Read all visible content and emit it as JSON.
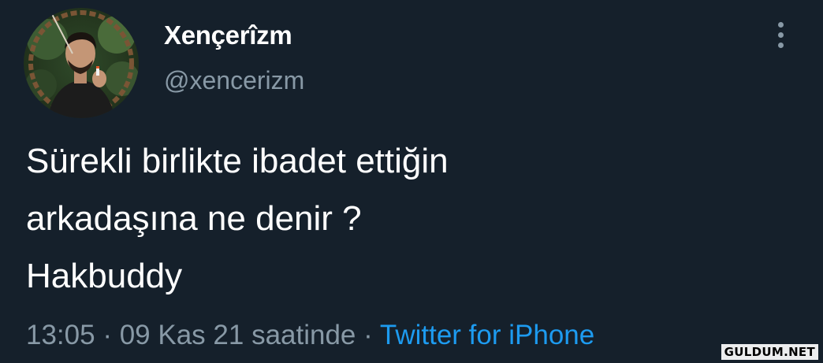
{
  "tweet": {
    "author": {
      "display_name": "Xençerîzm",
      "handle": "@xencerizm",
      "avatar": "profile-photo"
    },
    "more_icon": "more-vertical-icon",
    "text_lines": [
      "Sürekli birlikte ibadet ettiğin",
      "arkadaşına ne denir ?",
      "Hakbuddy"
    ],
    "meta": {
      "time": "13:05",
      "separator": "·",
      "date": "09 Kas 21 saatinde",
      "source": "Twitter for iPhone"
    }
  },
  "watermark": "GULDUM.NET",
  "colors": {
    "background": "#15202b",
    "primary_text": "#ffffff",
    "secondary_text": "#8899a6",
    "link": "#1d9bf0"
  }
}
